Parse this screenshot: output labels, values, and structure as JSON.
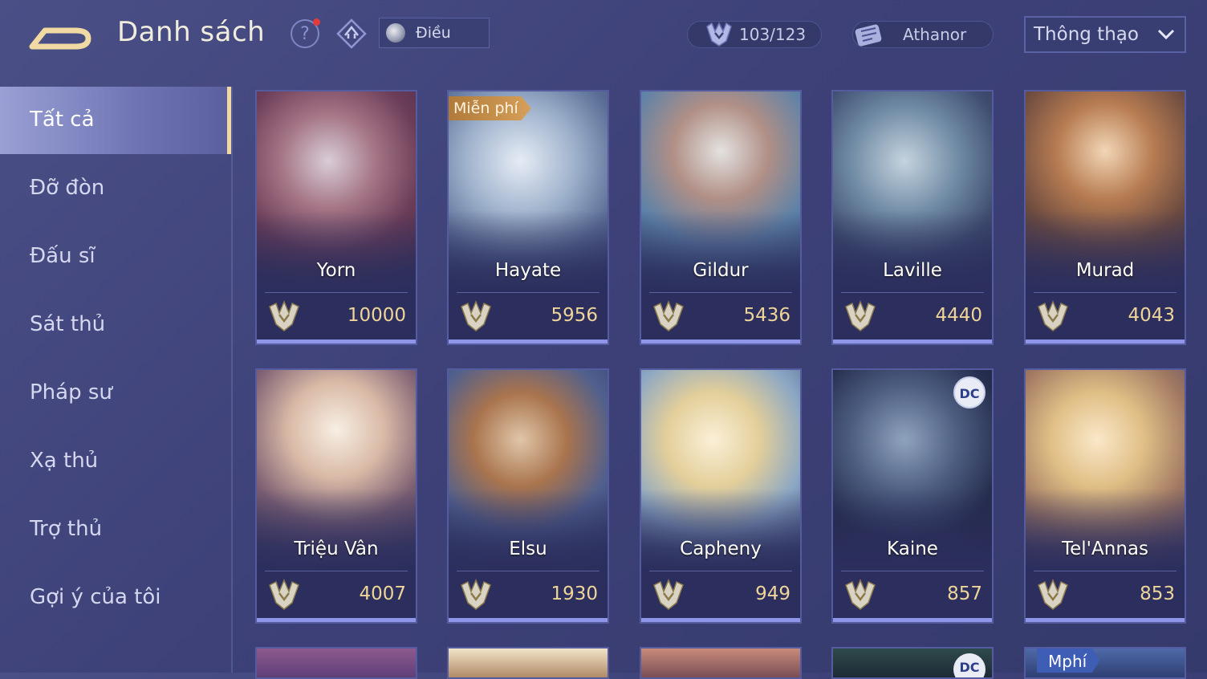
{
  "header": {
    "title": "Danh sách",
    "help_label": "?",
    "player_name": "Điều",
    "hero_count": "103/123",
    "sort_name": "Athanor",
    "filter_selected": "Thông thạo"
  },
  "sidebar": {
    "items": [
      {
        "label": "Tất cả",
        "active": true
      },
      {
        "label": "Đỡ đòn"
      },
      {
        "label": "Đấu sĩ"
      },
      {
        "label": "Sát thủ"
      },
      {
        "label": "Pháp sư"
      },
      {
        "label": "Xạ thủ"
      },
      {
        "label": "Trợ thủ"
      },
      {
        "label": "Gợi ý của tôi"
      }
    ]
  },
  "heroes": [
    {
      "name": "Yorn",
      "score": "10000"
    },
    {
      "name": "Hayate",
      "score": "5956",
      "tag": "Miễn phí"
    },
    {
      "name": "Gildur",
      "score": "5436"
    },
    {
      "name": "Laville",
      "score": "4440"
    },
    {
      "name": "Murad",
      "score": "4043"
    },
    {
      "name": "Triệu Vân",
      "score": "4007"
    },
    {
      "name": "Elsu",
      "score": "1930"
    },
    {
      "name": "Capheny",
      "score": "949"
    },
    {
      "name": "Kaine",
      "score": "857",
      "logo": "DC"
    },
    {
      "name": "Tel'Annas",
      "score": "853"
    }
  ],
  "peek_row": {
    "dc_logo": "DC",
    "tag": "Mphí"
  },
  "colors": {
    "background": "#3d4178",
    "accent_gold": "#efd598",
    "card_bar": "#8f95e8",
    "active_tab": "#9aa0d4"
  },
  "icons": {
    "back": "back-arrow-icon",
    "help": "help-icon",
    "rank": "rank-icon",
    "count": "hero-count-icon",
    "sort": "scroll-icon",
    "chevron": "chevron-down-icon",
    "mastery": "mastery-badge-icon"
  }
}
